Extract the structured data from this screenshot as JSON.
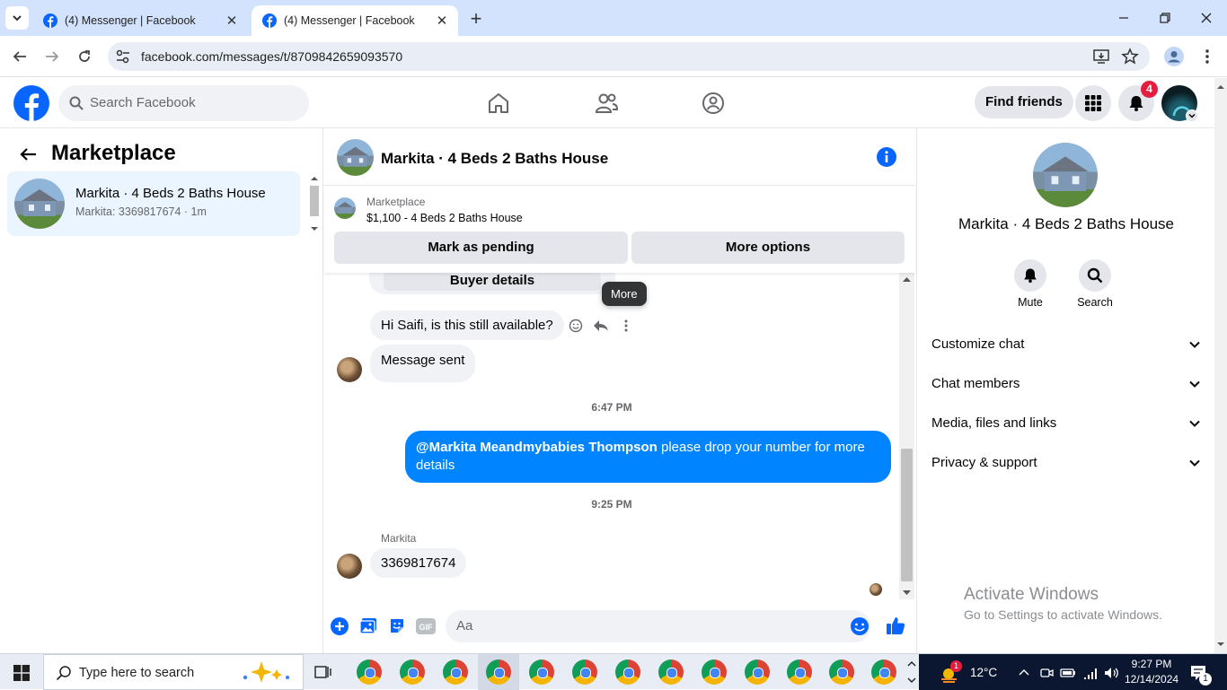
{
  "browser": {
    "tabs": [
      {
        "title": "(4) Messenger | Facebook"
      },
      {
        "title": "(4) Messenger | Facebook"
      }
    ],
    "url": "facebook.com/messages/t/8709842659093570"
  },
  "fb_header": {
    "search_placeholder": "Search Facebook",
    "find_friends": "Find friends",
    "notification_count": "4"
  },
  "left_panel": {
    "title": "Marketplace",
    "conversations": [
      {
        "name": "Markita · 4 Beds 2 Baths House",
        "subtitle": "Markita: 3369817674 · 1m"
      }
    ]
  },
  "chat": {
    "title": "Markita · 4 Beds 2 Baths House",
    "marketplace_label": "Marketplace",
    "listing": "$1,100 - 4 Beds 2 Baths House",
    "mark_pending": "Mark as pending",
    "more_options": "More options",
    "buyer_details": "Buyer details",
    "tooltip": "More",
    "messages": {
      "m1": "Hi Saifi, is this still available?",
      "m2": "Message sent",
      "ts1": "6:47 PM",
      "out_mention": "@Markita Meandmybabies Thompson",
      "out_text": " please drop your number for more details",
      "ts2": "9:25 PM",
      "sender": "Markita",
      "m3": "3369817674"
    },
    "composer_placeholder": "Aa"
  },
  "right_panel": {
    "name": "Markita · 4 Beds 2 Baths House",
    "mute": "Mute",
    "search": "Search",
    "sections": [
      "Customize chat",
      "Chat members",
      "Media, files and links",
      "Privacy & support"
    ]
  },
  "watermark": {
    "line1": "Activate Windows",
    "line2": "Go to Settings to activate Windows."
  },
  "taskbar": {
    "search_placeholder": "Type here to search",
    "weather": "12°C",
    "weather_badge": "1",
    "time": "9:27 PM",
    "date": "12/14/2024",
    "notif_count": "1"
  },
  "colors": {
    "fb_blue": "#0866ff",
    "messenger_blue": "#0084ff",
    "badge_red": "#e41e3f"
  }
}
